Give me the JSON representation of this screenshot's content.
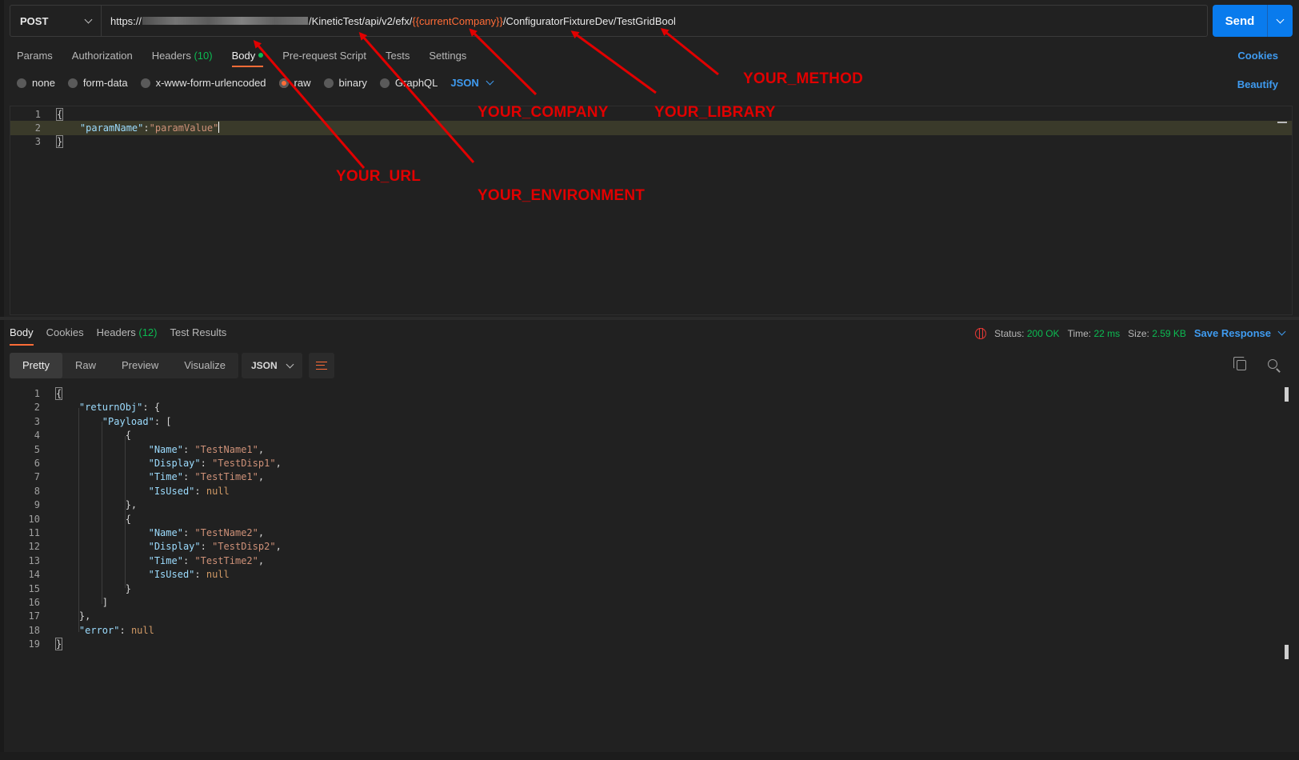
{
  "request": {
    "method": "POST",
    "url_prefix": "https://",
    "url_path": "/KineticTest/api/v2/efx/",
    "url_variable": "{{currentCompany}}",
    "url_suffix": "/ConfiguratorFixtureDev/TestGridBool",
    "send_label": "Send"
  },
  "request_tabs": {
    "params": "Params",
    "authorization": "Authorization",
    "headers": "Headers",
    "headers_count": "(10)",
    "body": "Body",
    "prerequest": "Pre-request Script",
    "tests": "Tests",
    "settings": "Settings",
    "cookies": "Cookies"
  },
  "body_modes": {
    "none": "none",
    "form_data": "form-data",
    "urlencoded": "x-www-form-urlencoded",
    "raw": "raw",
    "binary": "binary",
    "graphql": "GraphQL",
    "format": "JSON",
    "beautify": "Beautify"
  },
  "request_body": {
    "line_numbers": [
      "1",
      "2",
      "3"
    ],
    "open": "{",
    "key": "\"paramName\"",
    "colon": ":",
    "value": "\"paramValue\"",
    "close": "}"
  },
  "response_tabs": {
    "body": "Body",
    "cookies": "Cookies",
    "headers": "Headers",
    "headers_count": "(12)",
    "test_results": "Test Results"
  },
  "response_status": {
    "status_label": "Status:",
    "status_value": "200 OK",
    "time_label": "Time:",
    "time_value": "22 ms",
    "size_label": "Size:",
    "size_value": "2.59 KB",
    "save_response": "Save Response"
  },
  "view_modes": {
    "pretty": "Pretty",
    "raw": "Raw",
    "preview": "Preview",
    "visualize": "Visualize",
    "format": "JSON"
  },
  "response_body": {
    "line_numbers": [
      "1",
      "2",
      "3",
      "4",
      "5",
      "6",
      "7",
      "8",
      "9",
      "10",
      "11",
      "12",
      "13",
      "14",
      "15",
      "16",
      "17",
      "18",
      "19"
    ],
    "k_returnObj": "\"returnObj\"",
    "k_payload": "\"Payload\"",
    "k_name": "\"Name\"",
    "k_display": "\"Display\"",
    "k_time": "\"Time\"",
    "k_isused": "\"IsUsed\"",
    "k_error": "\"error\"",
    "v_name1": "\"TestName1\"",
    "v_disp1": "\"TestDisp1\"",
    "v_time1": "\"TestTime1\"",
    "v_name2": "\"TestName2\"",
    "v_disp2": "\"TestDisp2\"",
    "v_time2": "\"TestTime2\"",
    "v_null": "null"
  },
  "annotations": {
    "method": "YOUR_METHOD",
    "company": "YOUR_COMPANY",
    "library": "YOUR_LIBRARY",
    "url": "YOUR_URL",
    "environment": "YOUR_ENVIRONMENT",
    "color": "#e10000"
  },
  "colors": {
    "accent_orange": "#ff6c37",
    "link_blue": "#3f9bf0",
    "send_blue": "#097bed",
    "status_green": "#0cbb52"
  }
}
